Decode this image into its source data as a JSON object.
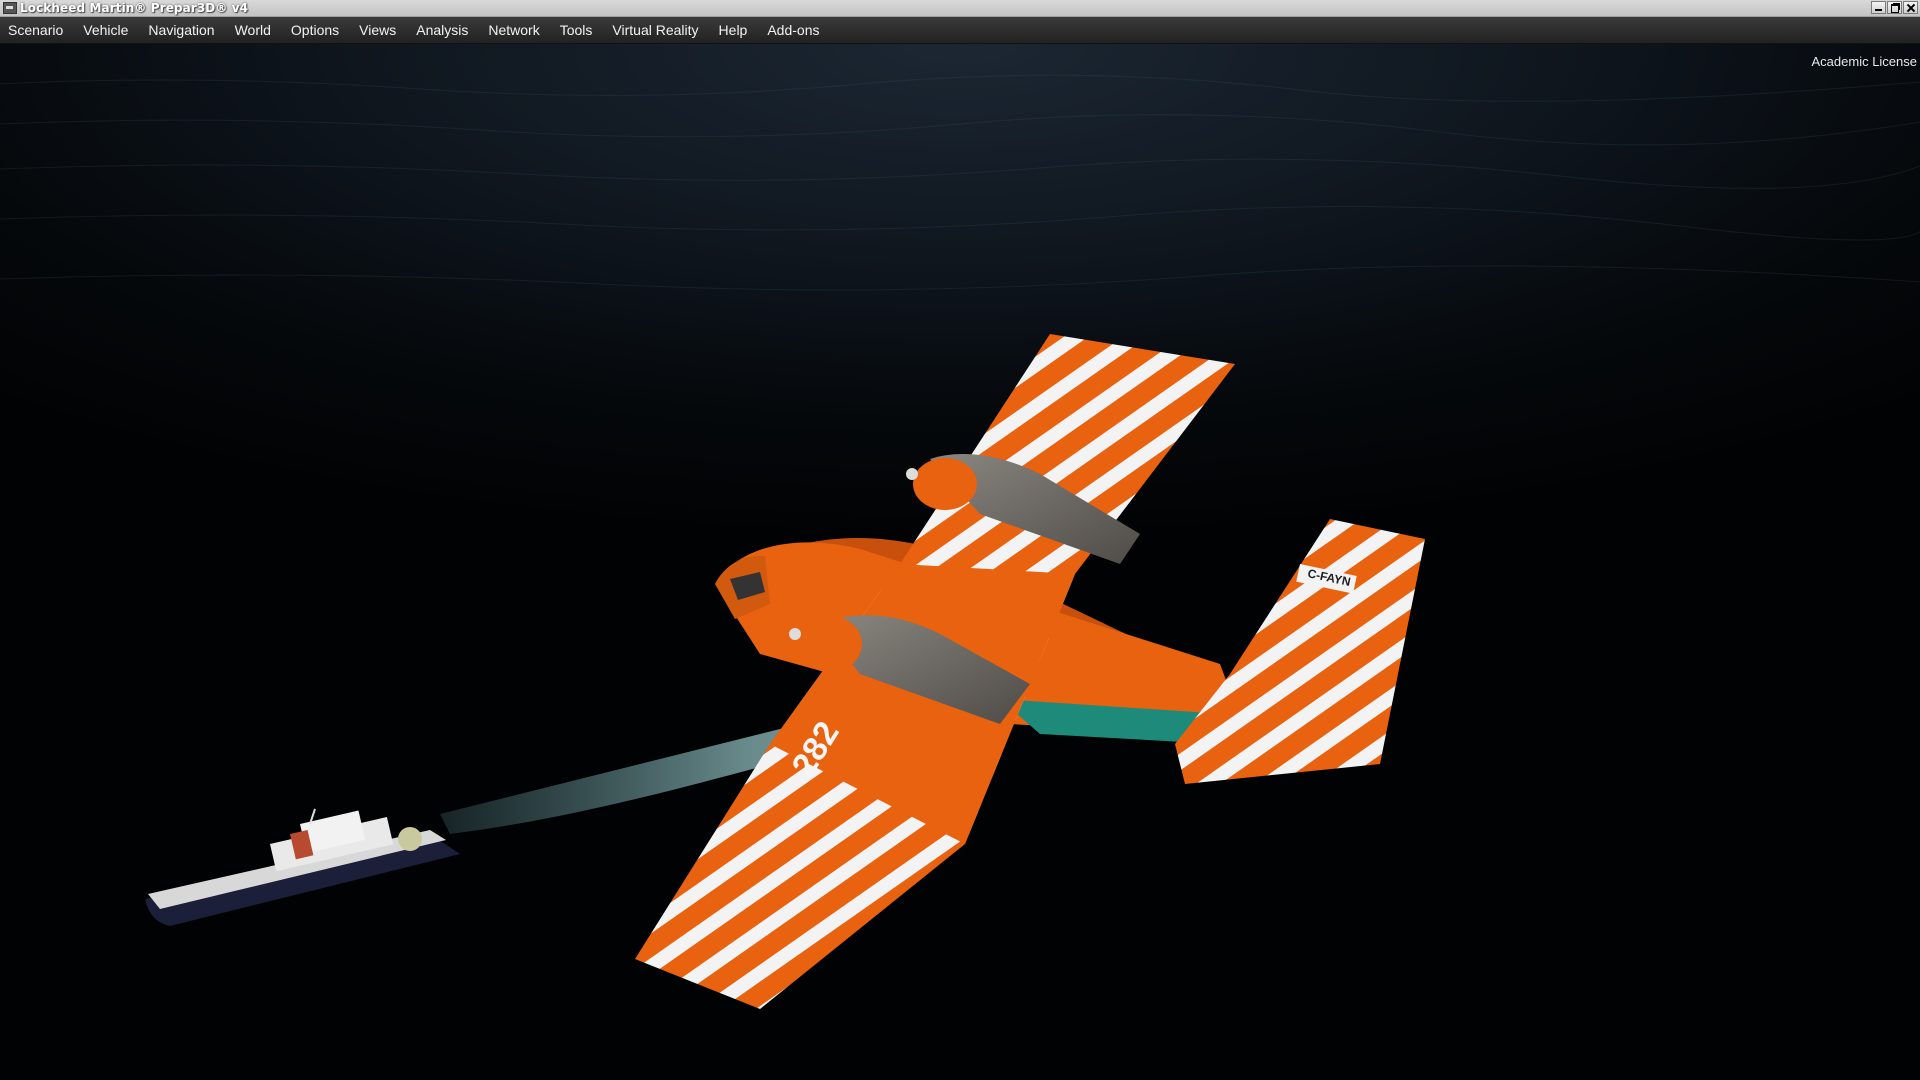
{
  "window": {
    "title": "Lockheed Martin® Prepar3D® v4",
    "app_icon": "prepar3d-app-icon",
    "controls": [
      "minimize-icon",
      "restore-icon",
      "close-icon"
    ]
  },
  "menubar": {
    "items": [
      {
        "label": "Scenario"
      },
      {
        "label": "Vehicle"
      },
      {
        "label": "Navigation"
      },
      {
        "label": "World"
      },
      {
        "label": "Options"
      },
      {
        "label": "Views"
      },
      {
        "label": "Analysis"
      },
      {
        "label": "Network"
      },
      {
        "label": "Tools"
      },
      {
        "label": "Virtual Reality"
      },
      {
        "label": "Help"
      },
      {
        "label": "Add-ons"
      }
    ]
  },
  "viewport": {
    "license_text": "Academic License",
    "aircraft": {
      "registration": "C-FAYN",
      "number": "282",
      "livery_colors": {
        "primary": "#e8620f",
        "stripe": "#f5f5f5",
        "accent": "#1e8a7a",
        "nacelle": "#6e6a64"
      }
    },
    "ship": {
      "hull_color": "#1b1f3a",
      "superstructure_color": "#e9e9e9"
    }
  }
}
